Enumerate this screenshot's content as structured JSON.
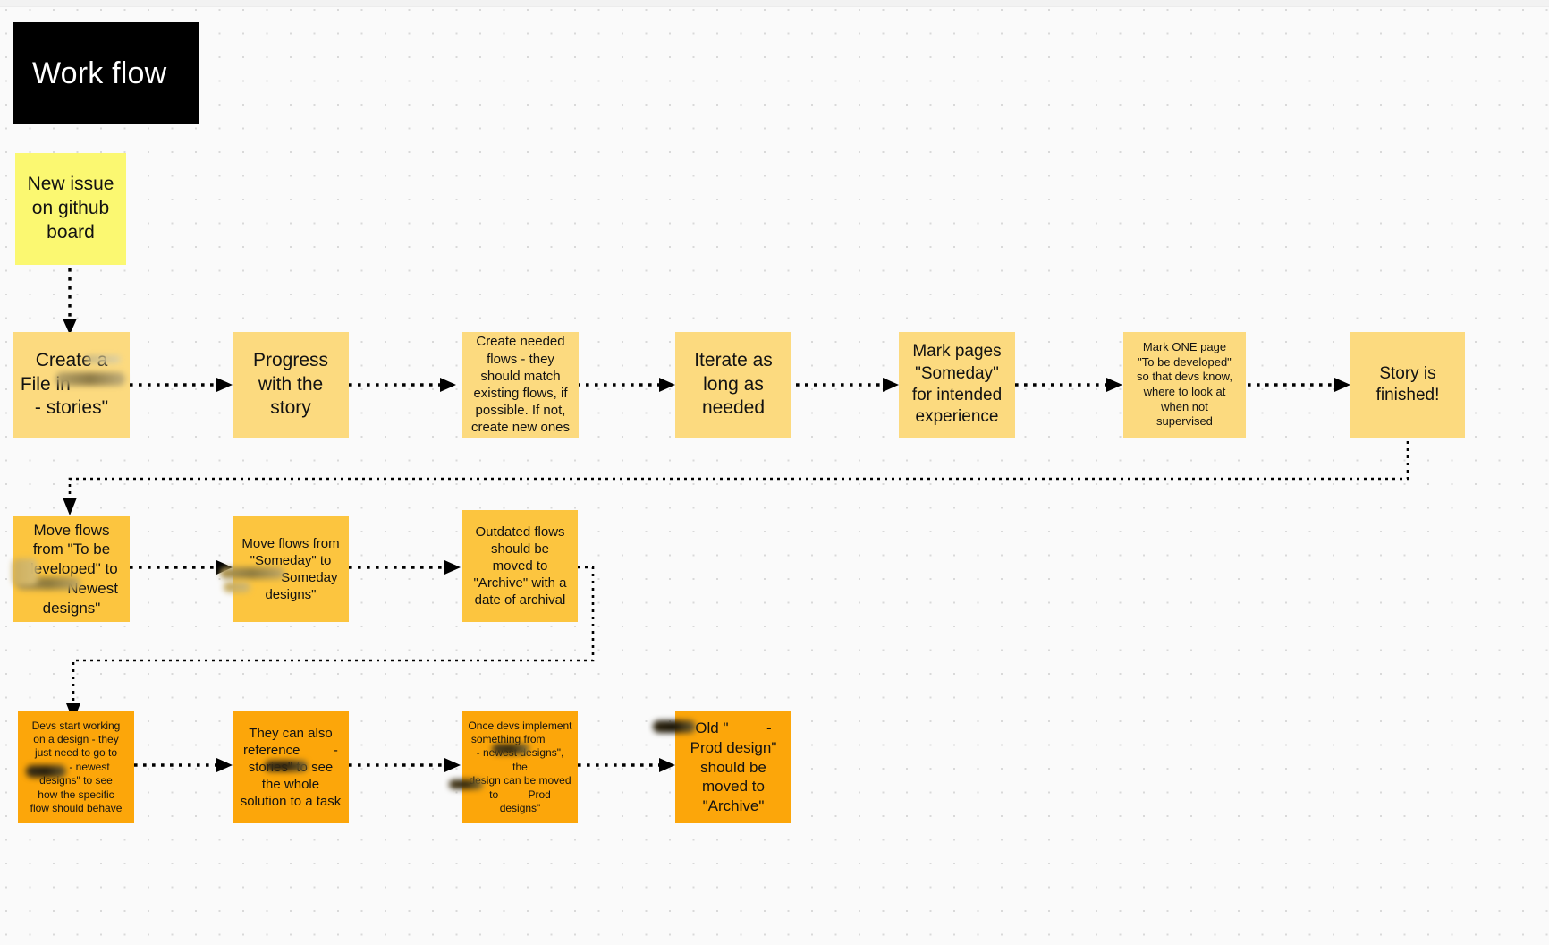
{
  "board": {
    "title_card": {
      "label": "Work flow"
    },
    "background": {
      "canvas_color": "#fafafa",
      "dot_color": "#d9d9d9"
    },
    "colors": {
      "title_bg": "#000000",
      "title_fg": "#ffffff",
      "sticky_bright_yellow": "#fbf871",
      "sticky_soft_yellow": "#fcda7f",
      "sticky_amber": "#fcc53f",
      "sticky_orange": "#fca60a",
      "connector": "#000000"
    }
  },
  "nodes": {
    "start": {
      "label": "New issue\non github\nboard"
    },
    "row1": [
      {
        "label": "Create a\nFile in          \n- stories\""
      },
      {
        "label": "Progress\nwith the\nstory"
      },
      {
        "label": "Create needed\nflows - they\nshould match\nexisting flows, if\npossible. If not,\ncreate new ones"
      },
      {
        "label": "Iterate as\nlong as\nneeded"
      },
      {
        "label": "Mark pages\n\"Someday\"\nfor intended\nexperience"
      },
      {
        "label": "Mark ONE page\n\"To be developed\"\nso that devs know,\nwhere to look at\nwhen not\nsupervised"
      },
      {
        "label": "Story is\nfinished!"
      }
    ],
    "row2": [
      {
        "label": "Move flows\nfrom \"To be\ndeveloped\" to\n          Newest\ndesigns\""
      },
      {
        "label": "Move flows from\n\"Someday\" to\n          Someday\ndesigns\""
      },
      {
        "label": "Outdated flows\nshould be\nmoved to\n\"Archive\" with a\ndate of archival"
      }
    ],
    "row3": [
      {
        "label": "Devs start working\non a design - they\njust need to go to\n         - newest\ndesigns\" to see\nhow the specific\nflow should behave"
      },
      {
        "label": "They can also\nreference         -\nstories\" to see\nthe whole\nsolution to a task"
      },
      {
        "label": "Once devs implement\nsomething from        \n- newest designs\", the\ndesign can be moved\nto          Prod\ndesigns\""
      },
      {
        "label": "Old \"         -\nProd design\"\nshould be\nmoved to\n\"Archive\""
      }
    ]
  }
}
